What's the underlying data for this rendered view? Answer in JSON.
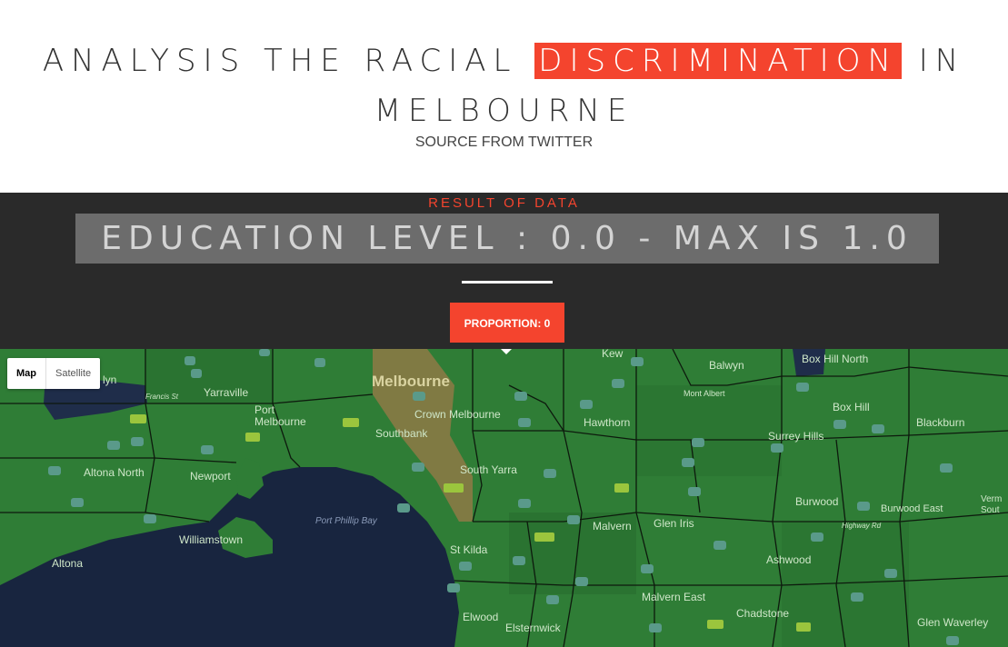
{
  "header": {
    "title_part1": "ANALYSIS THE RACIAL",
    "title_highlight": "DISCRIMINATION",
    "title_part2": "IN MELBOURNE",
    "subtitle": "SOURCE FROM TWITTER"
  },
  "result": {
    "heading": "RESULT OF DATA",
    "education_text": "EDUCATION LEVEL : 0.0 - MAX IS 1.0",
    "proportion_button": "PROPORTION: 0"
  },
  "map": {
    "type_control": {
      "map_label": "Map",
      "satellite_label": "Satellite"
    },
    "labels": {
      "melbourne": "Melbourne",
      "yarraville": "Yarraville",
      "port_melbourne": "Port Melbourne",
      "crown": "Crown Melbourne",
      "southbank": "Southbank",
      "kew": "Kew",
      "balwyn": "Balwyn",
      "box_hill_north": "Box Hill North",
      "mont_albert": "Mont Albert",
      "box_hill": "Box Hill",
      "blackburn": "Blackburn",
      "hawthorn": "Hawthorn",
      "surrey_hills": "Surrey Hills",
      "altona_north": "Altona North",
      "newport": "Newport",
      "south_yarra": "South Yarra",
      "port_phillip_bay": "Port Phillip Bay",
      "williamstown": "Williamstown",
      "malvern": "Malvern",
      "glen_iris": "Glen Iris",
      "burwood": "Burwood",
      "burwood_east": "Burwood East",
      "altona": "Altona",
      "st_kilda": "St Kilda",
      "ashwood": "Ashwood",
      "malvern_east": "Malvern East",
      "chadstone": "Chadstone",
      "elwood": "Elwood",
      "elsternwick": "Elsternwick",
      "glen_waverley": "Glen Waverley",
      "francis_st": "Francis St",
      "highway_rd": "Highway Rd",
      "vermont_south": "Verm Sout",
      "lyn": "lyn"
    },
    "colors": {
      "suburb": "#2f7d36",
      "water": "#18253f",
      "highlight": "#8a7a45",
      "boundary": "#0d1a0d",
      "label": "#cfe7c9",
      "shield": "#5a9a8a",
      "freeway": "#9bc53d"
    }
  }
}
